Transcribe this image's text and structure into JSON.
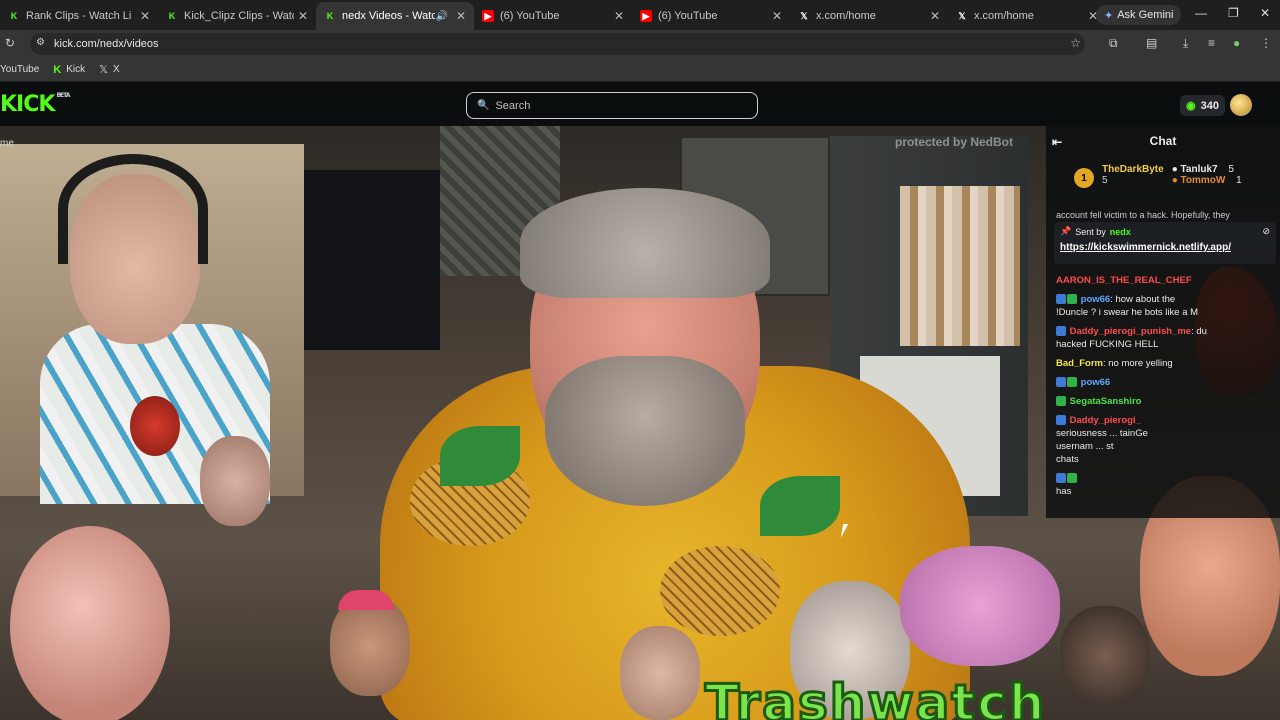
{
  "browser": {
    "tabs": [
      {
        "title": "Rank Clips - Watch Li",
        "favicon": "kick",
        "active": false
      },
      {
        "title": "Kick_Clipz Clips - Watch Live",
        "favicon": "kick",
        "active": false
      },
      {
        "title": "nedx Videos - Watch On",
        "favicon": "kick",
        "active": true,
        "audio": true
      },
      {
        "title": "(6) YouTube",
        "favicon": "youtube",
        "active": false
      },
      {
        "title": "(6) YouTube",
        "favicon": "youtube",
        "active": false
      },
      {
        "title": "x.com/home",
        "favicon": "x",
        "active": false
      },
      {
        "title": "x.com/home",
        "favicon": "x",
        "active": false
      }
    ],
    "gemini_label": "Ask Gemini",
    "url": "kick.com/nedx/videos",
    "bookmarks": [
      {
        "label": "YouTube",
        "icon": "youtube"
      },
      {
        "label": "Kick",
        "icon": "kick"
      },
      {
        "label": "X",
        "icon": "x"
      }
    ]
  },
  "kick": {
    "logo": "KICK",
    "logo_tag": "BETA",
    "search_placeholder": "Search",
    "points": "340",
    "sidebar_fragment": "me"
  },
  "video": {
    "watermark": "protected by NedBot",
    "banner_text": "Trashwatch"
  },
  "chat": {
    "title": "Chat",
    "leaderboard": {
      "first": {
        "rank": "1",
        "name": "TheDarkByte",
        "count": "5"
      },
      "others": [
        {
          "name": "Tanluk7",
          "count": "5"
        },
        {
          "name": "TommoW",
          "count": "1"
        }
      ]
    },
    "partial_top": "account fell victim to a hack. Hopefully, they",
    "pinned": {
      "sent_by_label": "Sent by",
      "sender": "nedx",
      "link": "https://kickswimmernick.netlify.app/"
    },
    "messages": [
      {
        "user": "AARON_IS_THE_REAL_CHEF",
        "color": "#ff4b4b",
        "text": ""
      },
      {
        "user": "pow66",
        "color": "#5aa8ff",
        "text": ": how about the"
      },
      {
        "user": "",
        "color": "#eaeaea",
        "text": "!Duncle ? i swear he bots like a M"
      },
      {
        "user": "Daddy_pierogi_punish_me",
        "color": "#ff4b4b",
        "text": ": du"
      },
      {
        "user": "",
        "color": "#eaeaea",
        "text": "hacked FUCKING HELL"
      },
      {
        "user": "Bad_Form",
        "color": "#f2e84a",
        "text": ": no more yelling"
      },
      {
        "user": "pow66",
        "color": "#5aa8ff",
        "text": ""
      },
      {
        "user": "SegataSanshiro",
        "color": "#4be34b",
        "text": ""
      },
      {
        "user": "Daddy_pierogi_",
        "color": "#ff4b4b",
        "text": ""
      },
      {
        "user": "",
        "color": "#eaeaea",
        "text": "seriousness ... tainGe"
      },
      {
        "user": "",
        "color": "#eaeaea",
        "text": "usernam ... st"
      },
      {
        "user": "",
        "color": "#eaeaea",
        "text": "chats"
      },
      {
        "user": "",
        "color": "#eaeaea",
        "text": ""
      },
      {
        "user": "",
        "color": "#eaeaea",
        "text": "has"
      }
    ]
  },
  "colors": {
    "kick_green": "#53fc18",
    "background": "#0b0e0f"
  }
}
